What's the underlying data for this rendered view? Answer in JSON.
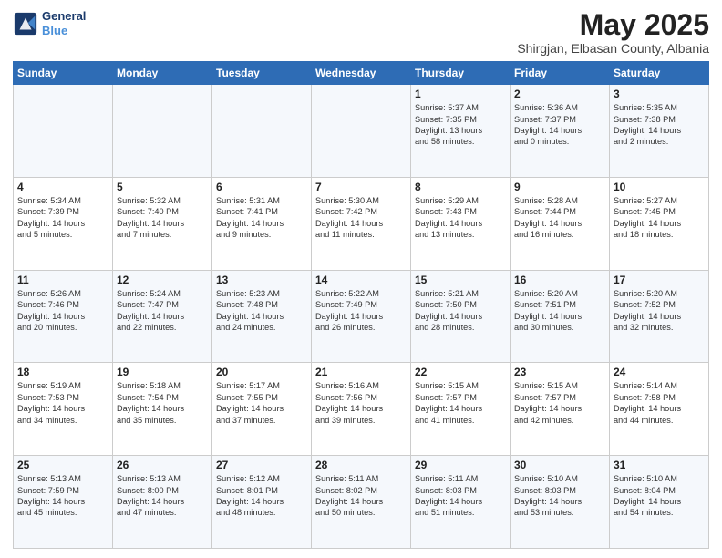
{
  "logo": {
    "line1": "General",
    "line2": "Blue"
  },
  "title": "May 2025",
  "subtitle": "Shirgjan, Elbasan County, Albania",
  "days_header": [
    "Sunday",
    "Monday",
    "Tuesday",
    "Wednesday",
    "Thursday",
    "Friday",
    "Saturday"
  ],
  "weeks": [
    [
      {
        "day": "",
        "text": ""
      },
      {
        "day": "",
        "text": ""
      },
      {
        "day": "",
        "text": ""
      },
      {
        "day": "",
        "text": ""
      },
      {
        "day": "1",
        "text": "Sunrise: 5:37 AM\nSunset: 7:35 PM\nDaylight: 13 hours\nand 58 minutes."
      },
      {
        "day": "2",
        "text": "Sunrise: 5:36 AM\nSunset: 7:37 PM\nDaylight: 14 hours\nand 0 minutes."
      },
      {
        "day": "3",
        "text": "Sunrise: 5:35 AM\nSunset: 7:38 PM\nDaylight: 14 hours\nand 2 minutes."
      }
    ],
    [
      {
        "day": "4",
        "text": "Sunrise: 5:34 AM\nSunset: 7:39 PM\nDaylight: 14 hours\nand 5 minutes."
      },
      {
        "day": "5",
        "text": "Sunrise: 5:32 AM\nSunset: 7:40 PM\nDaylight: 14 hours\nand 7 minutes."
      },
      {
        "day": "6",
        "text": "Sunrise: 5:31 AM\nSunset: 7:41 PM\nDaylight: 14 hours\nand 9 minutes."
      },
      {
        "day": "7",
        "text": "Sunrise: 5:30 AM\nSunset: 7:42 PM\nDaylight: 14 hours\nand 11 minutes."
      },
      {
        "day": "8",
        "text": "Sunrise: 5:29 AM\nSunset: 7:43 PM\nDaylight: 14 hours\nand 13 minutes."
      },
      {
        "day": "9",
        "text": "Sunrise: 5:28 AM\nSunset: 7:44 PM\nDaylight: 14 hours\nand 16 minutes."
      },
      {
        "day": "10",
        "text": "Sunrise: 5:27 AM\nSunset: 7:45 PM\nDaylight: 14 hours\nand 18 minutes."
      }
    ],
    [
      {
        "day": "11",
        "text": "Sunrise: 5:26 AM\nSunset: 7:46 PM\nDaylight: 14 hours\nand 20 minutes."
      },
      {
        "day": "12",
        "text": "Sunrise: 5:24 AM\nSunset: 7:47 PM\nDaylight: 14 hours\nand 22 minutes."
      },
      {
        "day": "13",
        "text": "Sunrise: 5:23 AM\nSunset: 7:48 PM\nDaylight: 14 hours\nand 24 minutes."
      },
      {
        "day": "14",
        "text": "Sunrise: 5:22 AM\nSunset: 7:49 PM\nDaylight: 14 hours\nand 26 minutes."
      },
      {
        "day": "15",
        "text": "Sunrise: 5:21 AM\nSunset: 7:50 PM\nDaylight: 14 hours\nand 28 minutes."
      },
      {
        "day": "16",
        "text": "Sunrise: 5:20 AM\nSunset: 7:51 PM\nDaylight: 14 hours\nand 30 minutes."
      },
      {
        "day": "17",
        "text": "Sunrise: 5:20 AM\nSunset: 7:52 PM\nDaylight: 14 hours\nand 32 minutes."
      }
    ],
    [
      {
        "day": "18",
        "text": "Sunrise: 5:19 AM\nSunset: 7:53 PM\nDaylight: 14 hours\nand 34 minutes."
      },
      {
        "day": "19",
        "text": "Sunrise: 5:18 AM\nSunset: 7:54 PM\nDaylight: 14 hours\nand 35 minutes."
      },
      {
        "day": "20",
        "text": "Sunrise: 5:17 AM\nSunset: 7:55 PM\nDaylight: 14 hours\nand 37 minutes."
      },
      {
        "day": "21",
        "text": "Sunrise: 5:16 AM\nSunset: 7:56 PM\nDaylight: 14 hours\nand 39 minutes."
      },
      {
        "day": "22",
        "text": "Sunrise: 5:15 AM\nSunset: 7:57 PM\nDaylight: 14 hours\nand 41 minutes."
      },
      {
        "day": "23",
        "text": "Sunrise: 5:15 AM\nSunset: 7:57 PM\nDaylight: 14 hours\nand 42 minutes."
      },
      {
        "day": "24",
        "text": "Sunrise: 5:14 AM\nSunset: 7:58 PM\nDaylight: 14 hours\nand 44 minutes."
      }
    ],
    [
      {
        "day": "25",
        "text": "Sunrise: 5:13 AM\nSunset: 7:59 PM\nDaylight: 14 hours\nand 45 minutes."
      },
      {
        "day": "26",
        "text": "Sunrise: 5:13 AM\nSunset: 8:00 PM\nDaylight: 14 hours\nand 47 minutes."
      },
      {
        "day": "27",
        "text": "Sunrise: 5:12 AM\nSunset: 8:01 PM\nDaylight: 14 hours\nand 48 minutes."
      },
      {
        "day": "28",
        "text": "Sunrise: 5:11 AM\nSunset: 8:02 PM\nDaylight: 14 hours\nand 50 minutes."
      },
      {
        "day": "29",
        "text": "Sunrise: 5:11 AM\nSunset: 8:03 PM\nDaylight: 14 hours\nand 51 minutes."
      },
      {
        "day": "30",
        "text": "Sunrise: 5:10 AM\nSunset: 8:03 PM\nDaylight: 14 hours\nand 53 minutes."
      },
      {
        "day": "31",
        "text": "Sunrise: 5:10 AM\nSunset: 8:04 PM\nDaylight: 14 hours\nand 54 minutes."
      }
    ]
  ]
}
